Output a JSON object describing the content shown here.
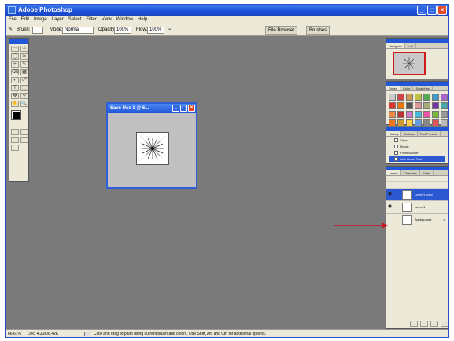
{
  "window": {
    "title": "Adobe Photoshop",
    "min": "_",
    "max": "□",
    "close": "×"
  },
  "menu": [
    "File",
    "Edit",
    "Image",
    "Layer",
    "Select",
    "Filter",
    "View",
    "Window",
    "Help"
  ],
  "options": {
    "brush_label": "Brush:",
    "mode_label": "Mode:",
    "mode_value": "Normal",
    "opacity_label": "Opacity:",
    "opacity_value": "100%",
    "flow_label": "Flow:",
    "flow_value": "100%",
    "file_browser": "File Browser",
    "brushes": "Brushes"
  },
  "document": {
    "title": "Save Use 1 @ 6...",
    "min": "_",
    "max": "□",
    "close": "×"
  },
  "panels": {
    "navigator_tabs": [
      "Navigator",
      "Info"
    ],
    "styles_tabs": [
      "Styles",
      "Color",
      "Swatches"
    ],
    "history_tabs": [
      "History",
      "Actions",
      "Tool Presets"
    ],
    "history_items": [
      "Open",
      "Brush",
      "Paint Bucket",
      "Use Brush Tool"
    ],
    "layers_tabs": [
      "Layers",
      "Channels",
      "Paths"
    ],
    "layers": [
      "Layer 1 copy",
      "Layer 1",
      "Background"
    ],
    "style_colors": [
      "#c9c9c9",
      "#c44",
      "#c95",
      "#c0c040",
      "#5a5",
      "#49c",
      "#a6c",
      "#d33",
      "#e70",
      "#555",
      "#d99",
      "#aa7",
      "#73a",
      "#4aa",
      "#e84",
      "#b33",
      "#c7c",
      "#4bd",
      "#e5a",
      "#7b3",
      "#999",
      "#e72",
      "#c93",
      "#fc4",
      "#69d",
      "#888",
      "#d55",
      "#bbb"
    ]
  },
  "tools": [
    "▭",
    "⊹",
    "◯",
    "✂",
    "⌗",
    "✎",
    "⌫",
    "▦",
    "◐",
    "☍",
    "T",
    "⬚",
    "✥",
    "⚲",
    "✋",
    "🔍"
  ],
  "status": {
    "zoom": "66.67%",
    "doc": "Doc: 4.21K/8.42K",
    "hint": "Click and drag to paint using current brush and colors. Use Shift, Alt, and Ctrl for additional options."
  },
  "colors": {
    "accent": "#1f57d8",
    "workspace": "#7a7a7a",
    "arrow": "#c8141e"
  }
}
